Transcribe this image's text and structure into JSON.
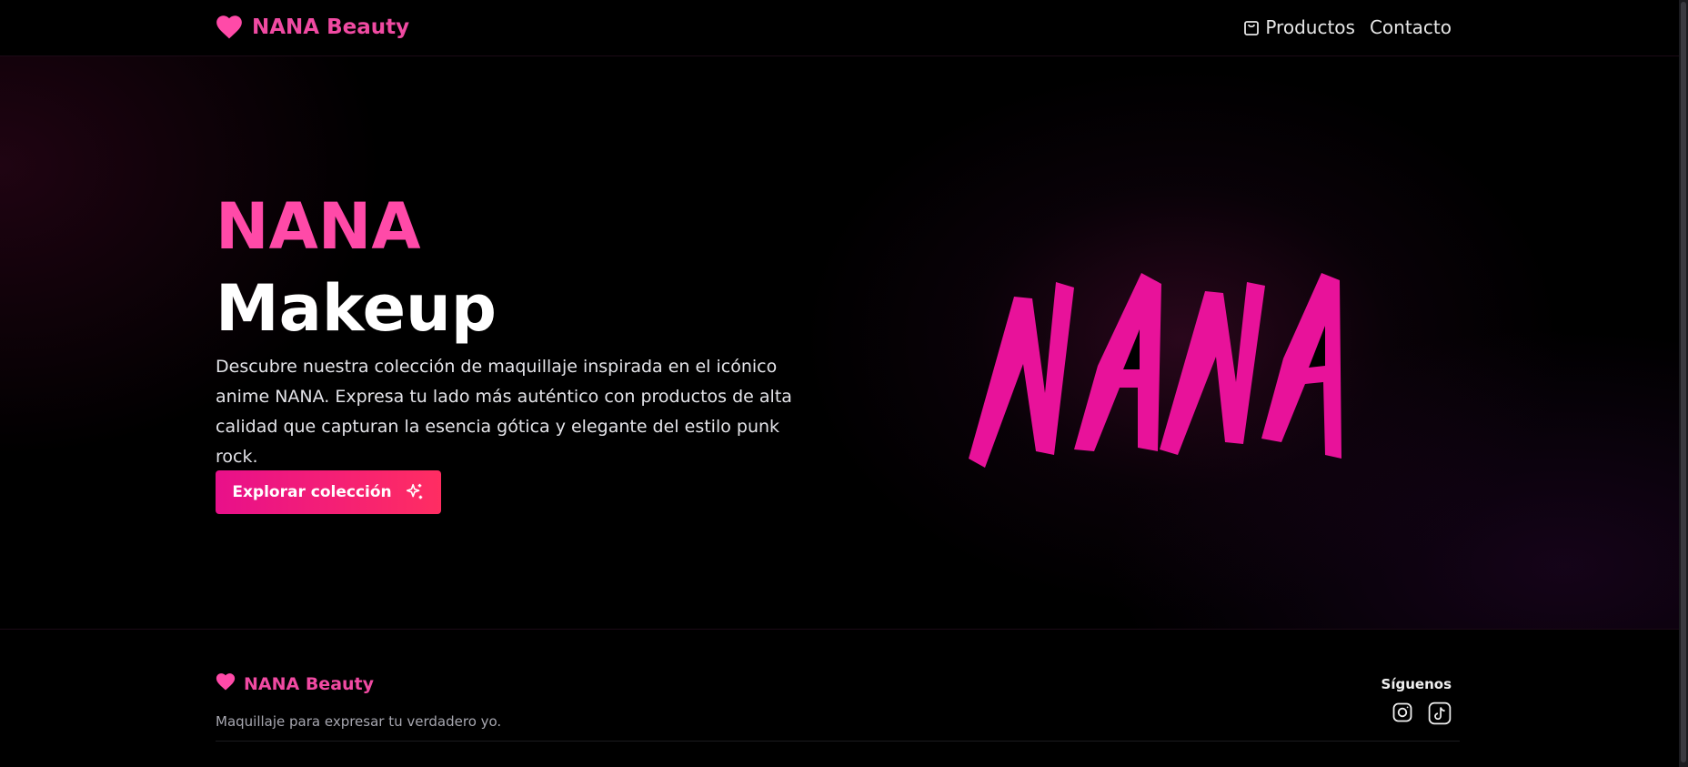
{
  "header": {
    "brand": "NANA Beauty",
    "nav": [
      {
        "label": "Productos",
        "icon": "shopping-bag-icon"
      },
      {
        "label": "Contacto"
      }
    ]
  },
  "hero": {
    "title_line1": "NANA",
    "title_line2": "Makeup",
    "description": "Descubre nuestra colección de maquillaje inspirada en el icónico anime NANA. Expresa tu lado más auténtico con productos de alta calidad que capturan la esencia gótica y elegante del estilo punk rock.",
    "cta_label": "Explorar colección",
    "cta_icon": "sparkles-icon",
    "logo_text": "NANA"
  },
  "footer": {
    "brand": "NANA Beauty",
    "tagline": "Maquillaje para expresar tu verdadero yo.",
    "social_title": "Síguenos",
    "social_icons": [
      "instagram-icon",
      "tiktok-icon"
    ]
  },
  "colors": {
    "accent": "#f04aa2",
    "hero_title": "#ff4aa8",
    "logo_magenta": "#e8129a",
    "cta_start": "#e8108a",
    "cta_end": "#ff2d62",
    "background": "#000000"
  }
}
